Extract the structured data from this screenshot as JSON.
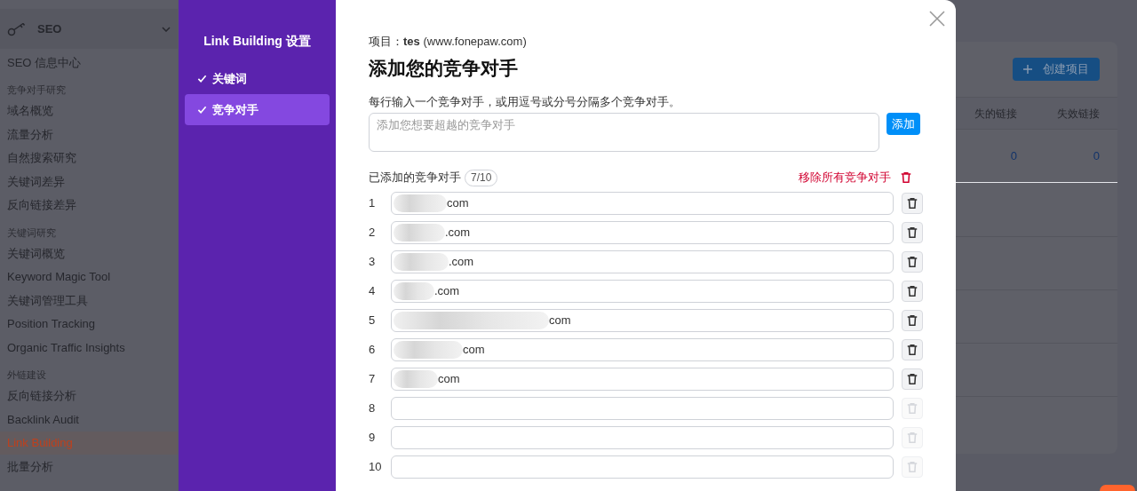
{
  "sidebar": {
    "header": {
      "label": "SEO"
    },
    "items": [
      {
        "kind": "item",
        "label": "SEO 信息中心",
        "selected": false
      },
      {
        "kind": "section",
        "label": "竞争对手研究"
      },
      {
        "kind": "item",
        "label": "域名概览",
        "selected": false
      },
      {
        "kind": "item",
        "label": "流量分析",
        "selected": false
      },
      {
        "kind": "item",
        "label": "自然搜索研究",
        "selected": false
      },
      {
        "kind": "item",
        "label": "关键词差异",
        "selected": false
      },
      {
        "kind": "item",
        "label": "反向链接差异",
        "selected": false
      },
      {
        "kind": "section",
        "label": "关键词研究"
      },
      {
        "kind": "item",
        "label": "关键词概览",
        "selected": false
      },
      {
        "kind": "item",
        "label": "Keyword Magic Tool",
        "selected": false
      },
      {
        "kind": "item",
        "label": "关键词管理工具",
        "selected": false
      },
      {
        "kind": "item",
        "label": "Position Tracking",
        "selected": false
      },
      {
        "kind": "item",
        "label": "Organic Traffic Insights",
        "selected": false
      },
      {
        "kind": "section",
        "label": "外链建设"
      },
      {
        "kind": "item",
        "label": "反向链接分析",
        "selected": false
      },
      {
        "kind": "item",
        "label": "Backlink Audit",
        "selected": false
      },
      {
        "kind": "item",
        "label": "Link Building",
        "selected": true
      },
      {
        "kind": "item",
        "label": "批量分析",
        "selected": false
      }
    ]
  },
  "background": {
    "create_button": "创建项目",
    "table": {
      "columns": [
        "失的链接",
        "失效链接"
      ],
      "rows": [
        [
          "0",
          "0"
        ]
      ]
    }
  },
  "modal": {
    "nav": {
      "title": "Link Building 设置",
      "steps": [
        {
          "label": "关键词",
          "done": true,
          "selected": false
        },
        {
          "label": "竞争对手",
          "done": true,
          "selected": true
        }
      ]
    },
    "project": "项目：**tes** (www.fonepaw.com)",
    "heading": "添加您的竞争对手",
    "instruction": "每行输入一个竞争对手，或用逗号或分号分隔多个竞争对手。",
    "input": {
      "placeholder": "添加您想要超越的竞争对手"
    },
    "add_button": "添加",
    "added_label": "已添加的竞争对手",
    "count": "7/10",
    "remove_all": "移除所有竞争对手",
    "competitors": [
      {
        "number": "1",
        "value": "com",
        "redacted": true
      },
      {
        "number": "2",
        "value": ".com",
        "redacted": true
      },
      {
        "number": "3",
        "value": ".com",
        "redacted": true
      },
      {
        "number": "4",
        "value": ".com",
        "redacted": true
      },
      {
        "number": "5",
        "value": "com",
        "redacted": true
      },
      {
        "number": "6",
        "value": "com",
        "redacted": true
      },
      {
        "number": "7",
        "value": "com",
        "redacted": true
      },
      {
        "number": "8",
        "redacted": false
      },
      {
        "number": "9",
        "redacted": false
      },
      {
        "number": "10",
        "redacted": false
      }
    ]
  }
}
